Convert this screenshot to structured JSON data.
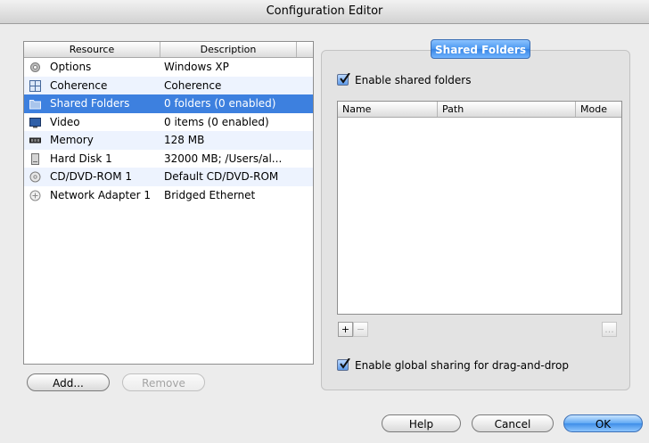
{
  "window": {
    "title": "Configuration Editor"
  },
  "resources": {
    "columns": [
      "Resource",
      "Description"
    ],
    "rows": [
      {
        "icon": "gear-icon",
        "name": "Options",
        "description": "Windows XP"
      },
      {
        "icon": "coherence-icon",
        "name": "Coherence",
        "description": "Coherence"
      },
      {
        "icon": "folder-icon",
        "name": "Shared Folders",
        "description": "0 folders (0 enabled)",
        "selected": true
      },
      {
        "icon": "monitor-icon",
        "name": "Video",
        "description": "0 items (0 enabled)"
      },
      {
        "icon": "memory-icon",
        "name": "Memory",
        "description": "128 MB"
      },
      {
        "icon": "hard-disk-icon",
        "name": "Hard Disk 1",
        "description": "32000 MB; /Users/al..."
      },
      {
        "icon": "cd-icon",
        "name": "CD/DVD-ROM 1",
        "description": "Default CD/DVD-ROM"
      },
      {
        "icon": "network-icon",
        "name": "Network Adapter 1",
        "description": "Bridged Ethernet"
      }
    ]
  },
  "buttons": {
    "add": "Add...",
    "remove": "Remove",
    "help": "Help",
    "cancel": "Cancel",
    "ok": "OK"
  },
  "shared_folders": {
    "tab_label": "Shared Folders",
    "enable_label": "Enable shared folders",
    "enable_checked": true,
    "columns": {
      "name": "Name",
      "path": "Path",
      "mode": "Mode"
    },
    "add_symbol": "+",
    "remove_symbol": "−",
    "more_symbol": "...",
    "drag_drop_label": "Enable global sharing for drag-and-drop",
    "drag_drop_checked": true
  }
}
